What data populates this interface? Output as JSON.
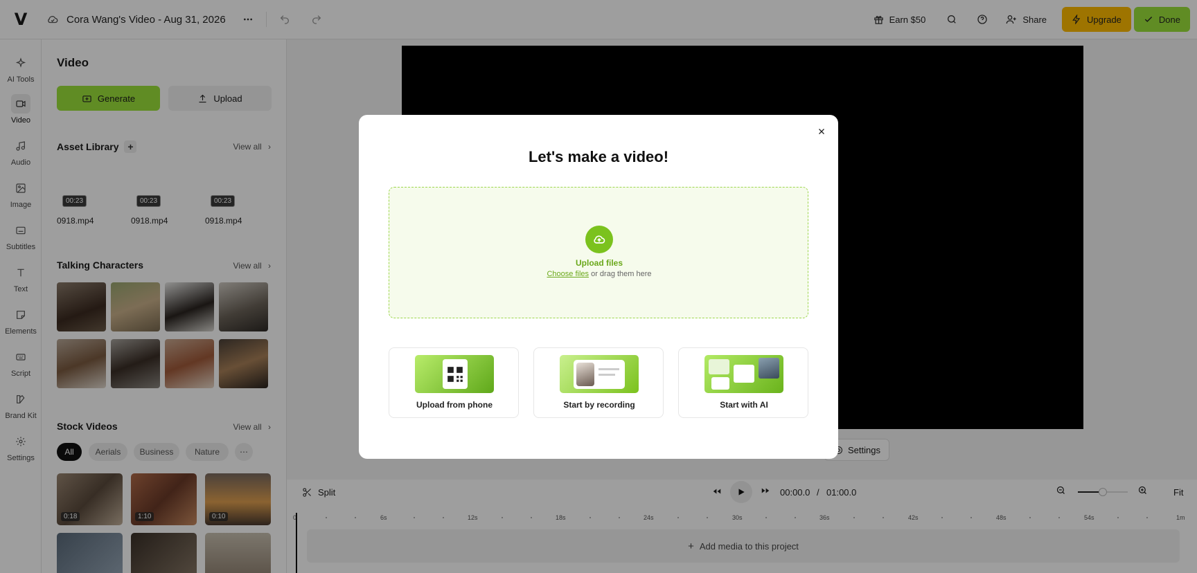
{
  "topbar": {
    "title": "Cora Wang's Video - Aug 31, 2026",
    "earn_label": "Earn $50",
    "share_label": "Share",
    "upgrade_label": "Upgrade",
    "done_label": "Done",
    "colors": {
      "upgrade": "#ffbc00",
      "done": "#9be23a"
    }
  },
  "rail": {
    "items": [
      {
        "label": "AI Tools",
        "icon": "sparkle-icon"
      },
      {
        "label": "Video",
        "icon": "video-camera-icon",
        "active": true
      },
      {
        "label": "Audio",
        "icon": "music-note-icon"
      },
      {
        "label": "Image",
        "icon": "image-icon"
      },
      {
        "label": "Subtitles",
        "icon": "subtitles-icon"
      },
      {
        "label": "Text",
        "icon": "text-icon"
      },
      {
        "label": "Elements",
        "icon": "elements-icon"
      },
      {
        "label": "Script",
        "icon": "script-icon"
      },
      {
        "label": "Brand Kit",
        "icon": "brand-kit-icon"
      },
      {
        "label": "Settings",
        "icon": "gear-icon"
      }
    ]
  },
  "panel": {
    "title": "Video",
    "generate_label": "Generate",
    "upload_label": "Upload",
    "asset_library": {
      "title": "Asset Library",
      "view_all": "View all",
      "items": [
        {
          "duration": "00:23",
          "name": "0918.mp4"
        },
        {
          "duration": "00:23",
          "name": "0918.mp4"
        },
        {
          "duration": "00:23",
          "name": "0918.mp4"
        }
      ]
    },
    "talking_characters": {
      "title": "Talking Characters",
      "view_all": "View all"
    },
    "stock_videos": {
      "title": "Stock Videos",
      "view_all": "View all",
      "chips": [
        "All",
        "Aerials",
        "Business",
        "Nature"
      ],
      "items": [
        {
          "duration": "0:18"
        },
        {
          "duration": "1:10"
        },
        {
          "duration": "0:10"
        }
      ]
    }
  },
  "canvas": {
    "settings_label": "Settings"
  },
  "timeline": {
    "split_label": "Split",
    "current_time": "00:00.0",
    "separator": "/",
    "total_time": "01:00.0",
    "fit_label": "Fit",
    "zoom_level": 0.5,
    "ticks": [
      "0",
      "6s",
      "12s",
      "18s",
      "24s",
      "30s",
      "36s",
      "42s",
      "48s",
      "54s",
      "1m"
    ],
    "add_media_label": "Add media to this project"
  },
  "modal": {
    "title": "Let's make a video!",
    "upload_label": "Upload files",
    "choose_link": "Choose files",
    "drag_text": "or drag them here",
    "cards": [
      {
        "label": "Upload from phone"
      },
      {
        "label": "Start by recording"
      },
      {
        "label": "Start with AI"
      }
    ],
    "accent": "#7bc21e"
  }
}
